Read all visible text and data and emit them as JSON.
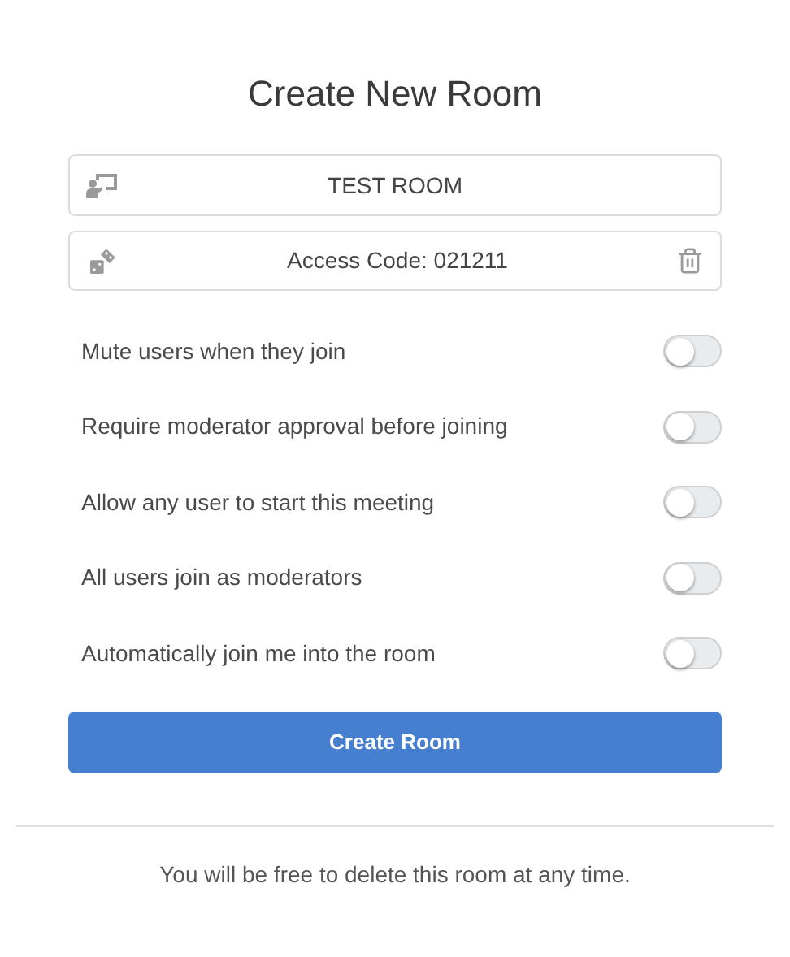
{
  "title": "Create New Room",
  "room_name": {
    "value": "TEST ROOM"
  },
  "access_code": {
    "label": "Access Code: 021211"
  },
  "settings": [
    {
      "label": "Mute users when they join",
      "on": false
    },
    {
      "label": "Require moderator approval before joining",
      "on": false
    },
    {
      "label": "Allow any user to start this meeting",
      "on": false
    },
    {
      "label": "All users join as moderators",
      "on": false
    },
    {
      "label": "Automatically join me into the room",
      "on": false
    }
  ],
  "create_button": "Create Room",
  "footer": "You will be free to delete this room at any time."
}
